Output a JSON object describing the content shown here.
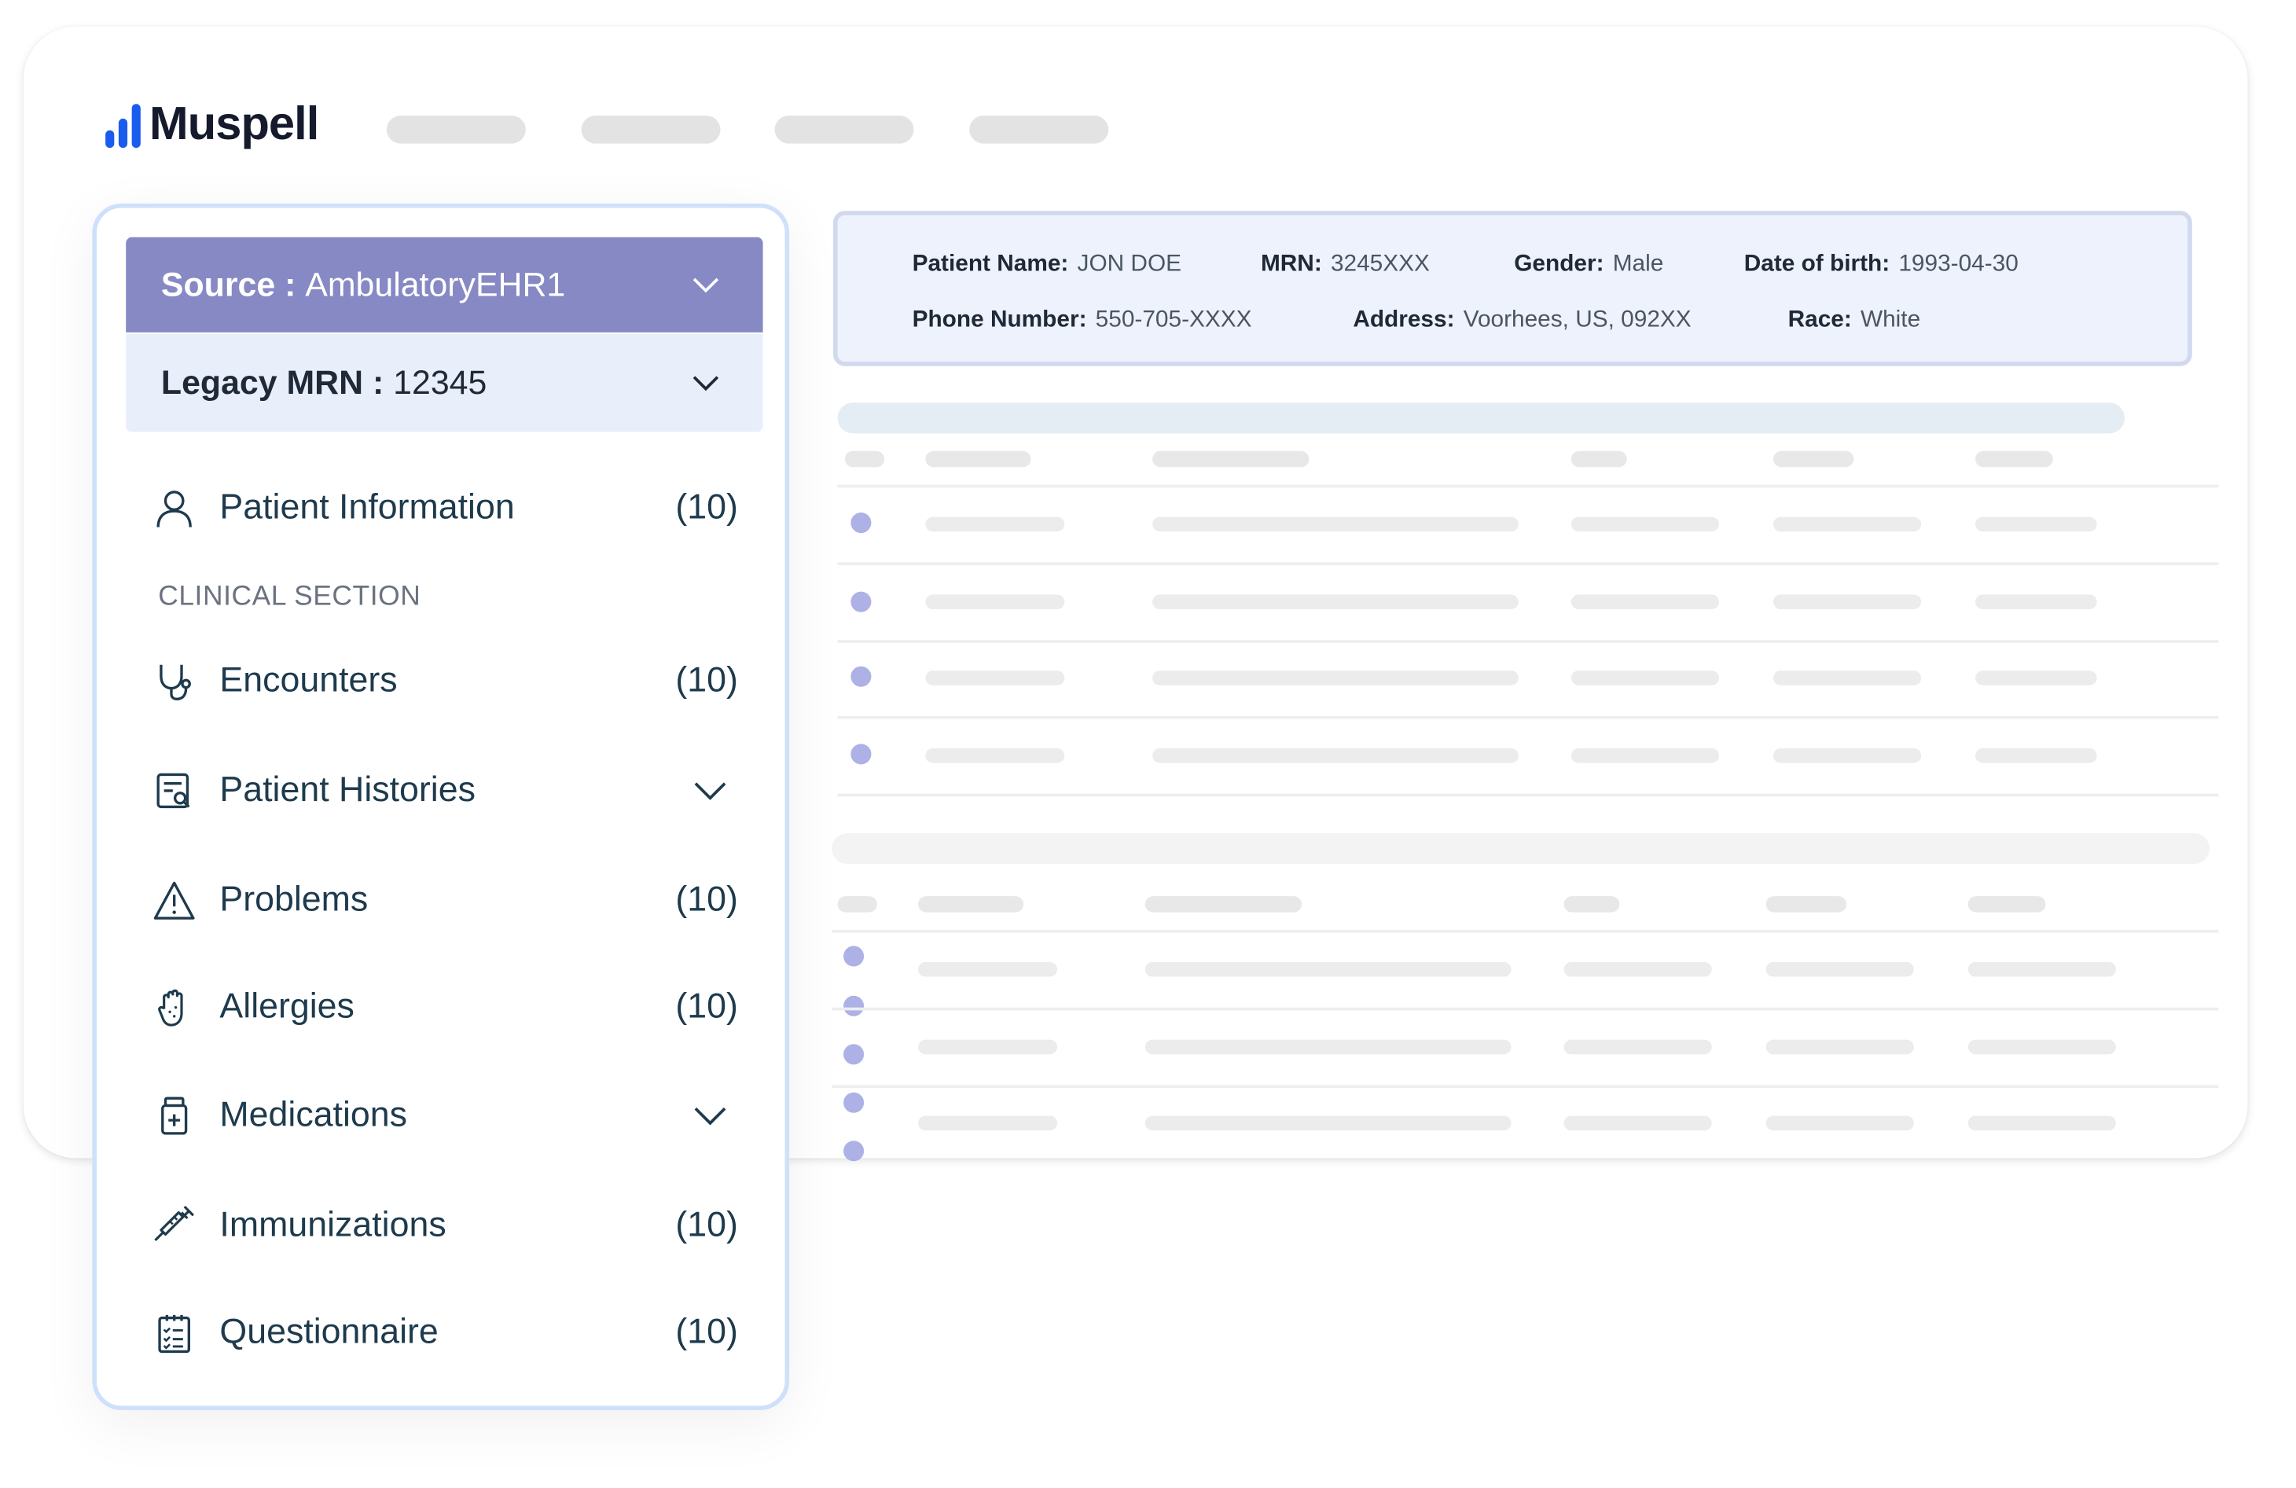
{
  "brand": {
    "name": "Muspell"
  },
  "sidebar": {
    "source": {
      "label": "Source :",
      "value": "AmbulatoryEHR1"
    },
    "legacy_mrn": {
      "label": "Legacy MRN :",
      "value": "12345"
    },
    "patient_information": {
      "label": "Patient Information",
      "count": "(10)"
    },
    "clinical_section_label": "CLINICAL SECTION",
    "items": [
      {
        "label": "Encounters",
        "count": "(10)"
      },
      {
        "label": "Patient Histories",
        "count": ""
      },
      {
        "label": "Problems",
        "count": "(10)"
      },
      {
        "label": "Allergies",
        "count": "(10)"
      },
      {
        "label": "Medications",
        "count": ""
      },
      {
        "label": "Immunizations",
        "count": "(10)"
      },
      {
        "label": "Questionnaire",
        "count": "(10)"
      }
    ]
  },
  "patient": {
    "name": {
      "label": "Patient Name:",
      "value": "JON DOE"
    },
    "mrn": {
      "label": "MRN:",
      "value": "3245XXX"
    },
    "gender": {
      "label": "Gender:",
      "value": "Male"
    },
    "dob": {
      "label": "Date of birth:",
      "value": "1993-04-30"
    },
    "phone": {
      "label": "Phone Number:",
      "value": "550-705-XXXX"
    },
    "address": {
      "label": "Address:",
      "value": "Voorhees, US, 092XX"
    },
    "race": {
      "label": "Race:",
      "value": "White"
    }
  },
  "colors": {
    "brand_blue": "#1b5cf0",
    "source_bar": "#8789c5",
    "mrn_bar": "#e9eefb",
    "info_box": "#eef2fc",
    "placeholder_dot": "#aeb1e6"
  }
}
